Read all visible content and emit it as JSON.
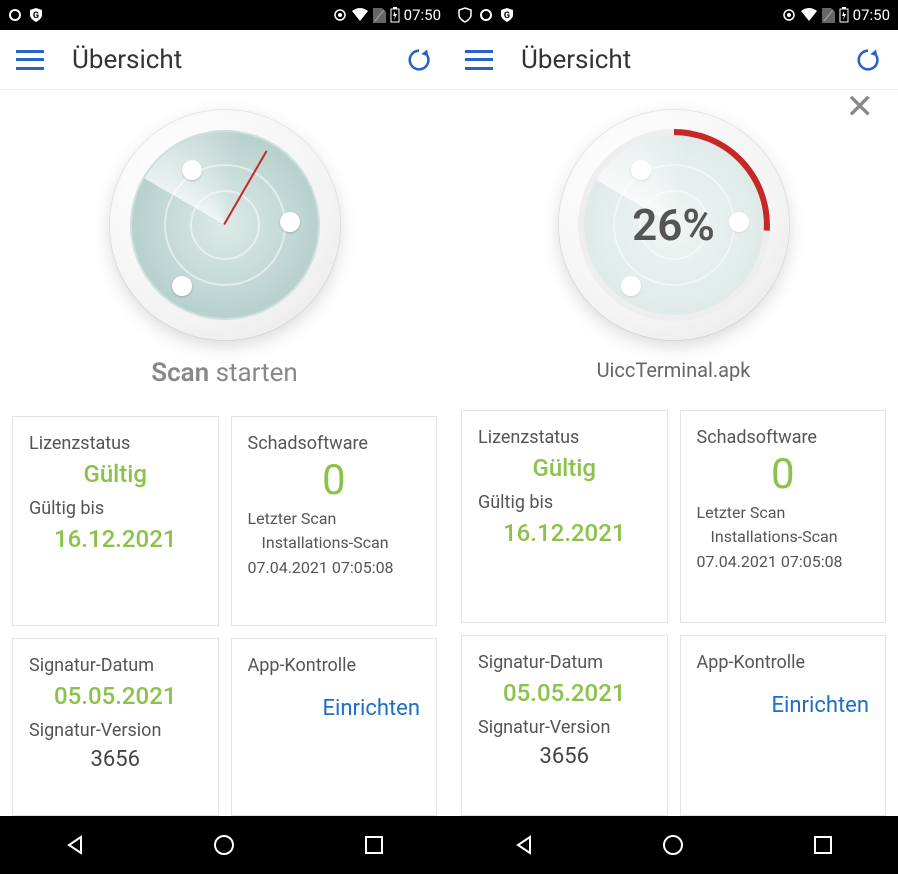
{
  "status": {
    "time": "07:50"
  },
  "header": {
    "title": "Übersicht"
  },
  "left": {
    "scan": {
      "caption_strong": "Scan",
      "caption_rest": " starten"
    }
  },
  "right": {
    "scan": {
      "percent": "26%",
      "file": "UiccTerminal.apk"
    }
  },
  "tiles": {
    "license": {
      "title": "Lizenzstatus",
      "value": "Gültig",
      "until_label": "Gültig bis",
      "until": "16.12.2021"
    },
    "malware": {
      "title": "Schadsoftware",
      "value": "0",
      "last1": "Letzter Scan",
      "last2": "Installations-Scan",
      "last3": "07.04.2021 07:05:08"
    },
    "sig": {
      "title": "Signatur-Datum",
      "value": "05.05.2021",
      "ver_label": "Signatur-Version",
      "ver": "3656"
    },
    "appctl": {
      "title": "App-Kontrolle",
      "link": "Einrichten"
    }
  }
}
